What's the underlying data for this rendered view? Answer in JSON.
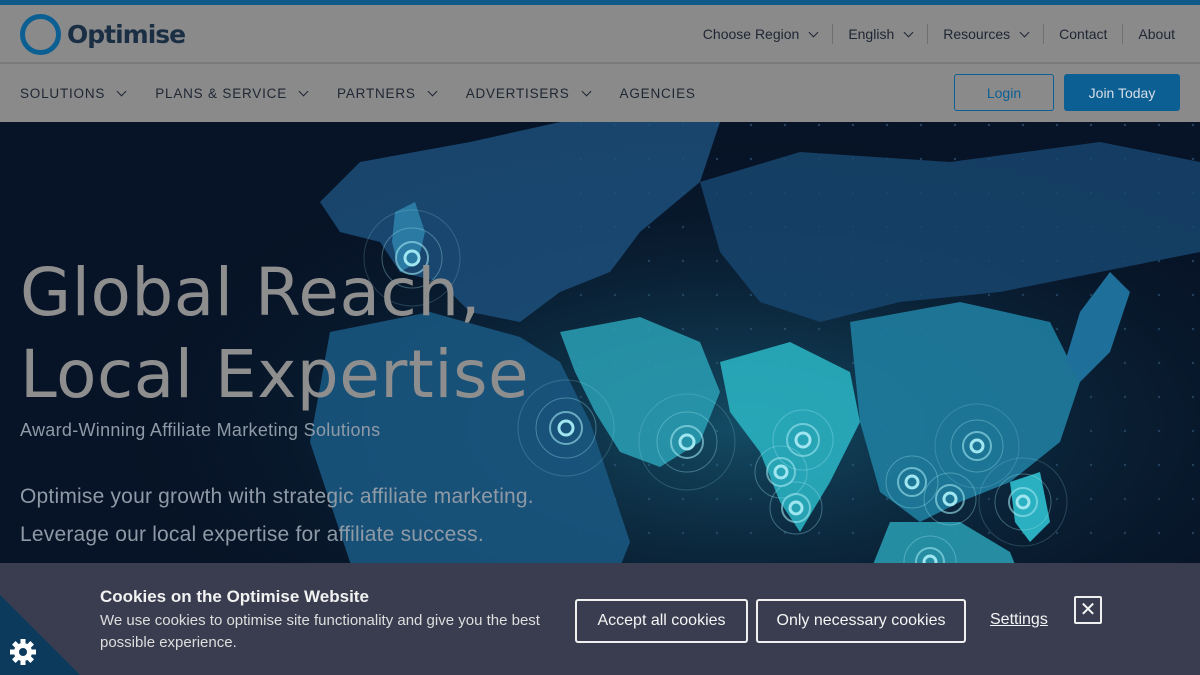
{
  "colors": {
    "brand_blue": "#0b5f93",
    "hero_bg": "#071326",
    "map_teal": "#19a3b8",
    "cookie_bg": "#3a3d4f"
  },
  "logo": {
    "text": "Optimise"
  },
  "topnav": {
    "items": [
      {
        "label": "Choose Region",
        "icon": "chevron-down-icon"
      },
      {
        "label": "English",
        "icon": "chevron-down-icon"
      },
      {
        "label": "Resources",
        "icon": "chevron-down-icon"
      },
      {
        "label": "Contact"
      },
      {
        "label": "About"
      }
    ]
  },
  "mainnav": {
    "links": [
      {
        "label": "SOLUTIONS",
        "icon": "chevron-down-icon"
      },
      {
        "label": "PLANS & SERVICE",
        "icon": "chevron-down-icon"
      },
      {
        "label": "PARTNERS",
        "icon": "chevron-down-icon"
      },
      {
        "label": "ADVERTISERS",
        "icon": "chevron-down-icon"
      },
      {
        "label": "AGENCIES"
      }
    ],
    "login_label": "Login",
    "join_label": "Join Today"
  },
  "hero": {
    "title_line1": "Global Reach,",
    "title_line2": "Local Expertise",
    "subtitle": "Award-Winning Affiliate Marketing Solutions",
    "desc_line1": "Optimise your growth with strategic affiliate marketing.",
    "desc_line2": "Leverage our local expertise for affiliate success."
  },
  "cookie": {
    "title": "Cookies on the Optimise Website",
    "text": "We use cookies to optimise site functionality and give you the best possible experience.",
    "accept_label": "Accept all cookies",
    "necessary_label": "Only necessary cookies",
    "settings_label": "Settings",
    "close_symbol": "✕",
    "corner_icon": "cookie-gear-icon"
  }
}
